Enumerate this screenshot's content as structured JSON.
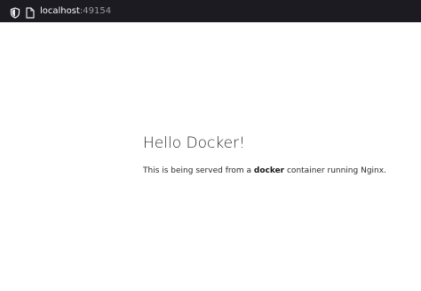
{
  "browser": {
    "url_host": "localhost",
    "url_port": ":49154"
  },
  "page": {
    "heading": "Hello Docker!",
    "text_before": "This is being served from a ",
    "text_bold": "docker",
    "text_after": " container running Nginx."
  },
  "colors": {
    "toolbar_background": "#1c1b22",
    "url_host": "#fbfbfe",
    "url_port": "#9a99a2",
    "page_background": "#ffffff",
    "text": "#2b2b2b"
  }
}
